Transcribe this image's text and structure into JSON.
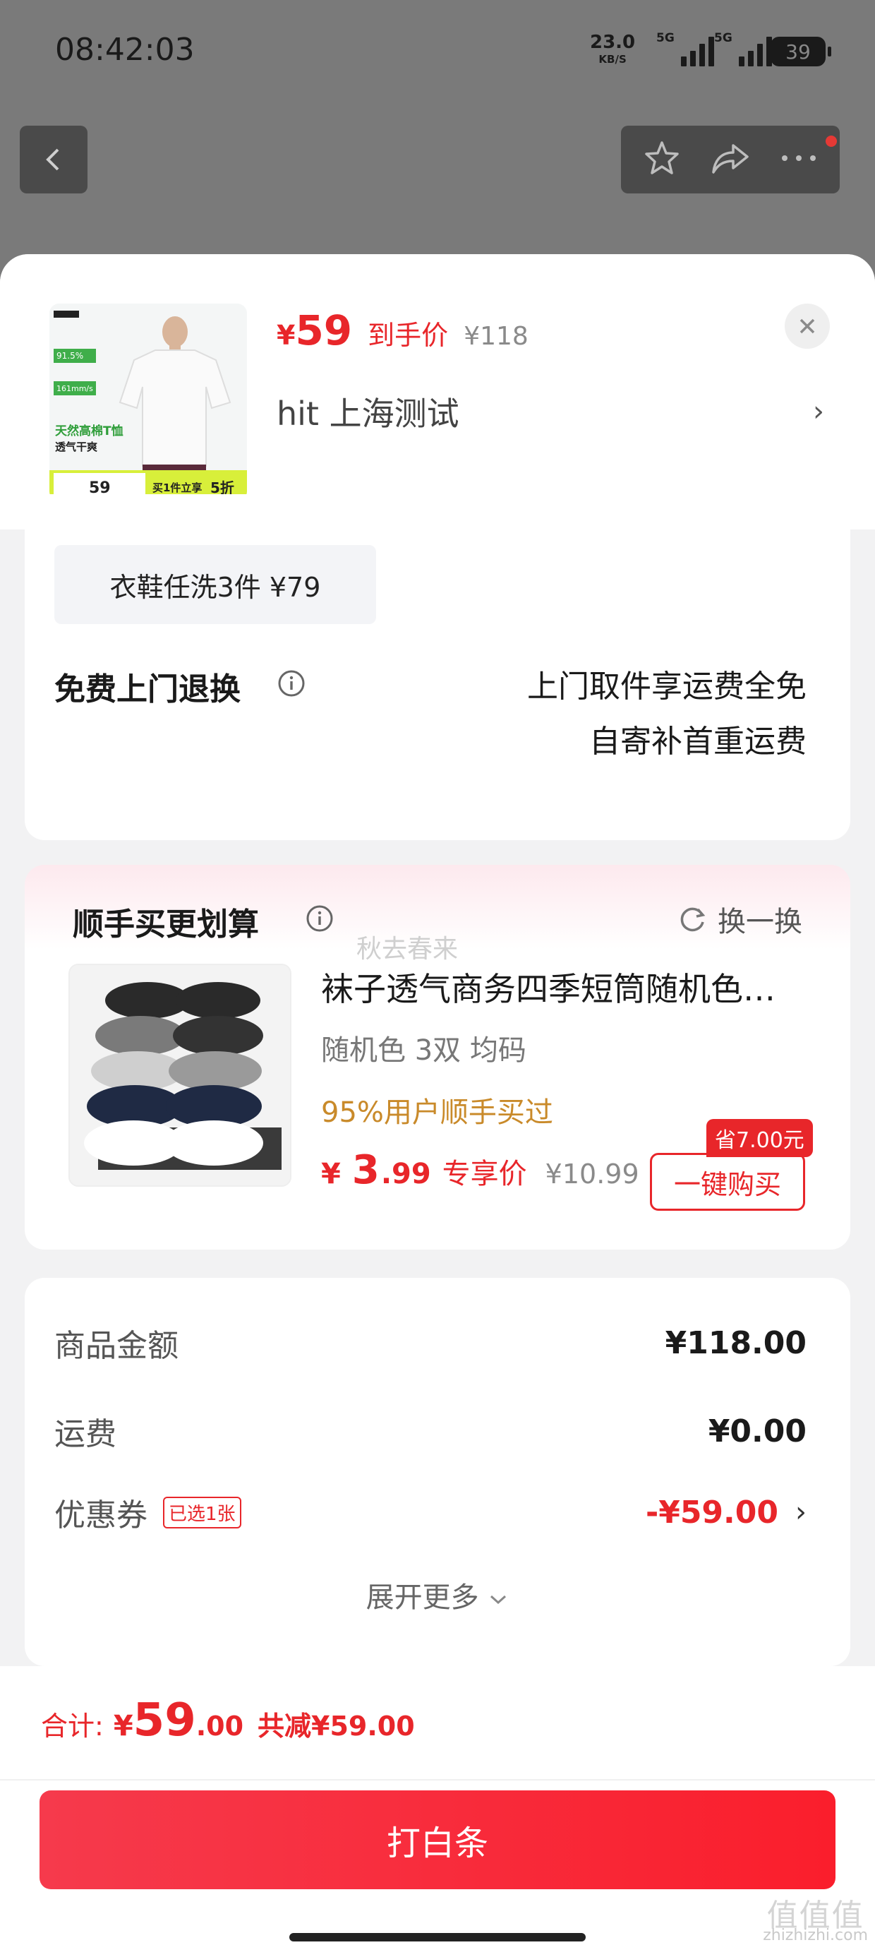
{
  "status_bar": {
    "time": "08:42:03",
    "net_speed": "23.0",
    "net_unit": "KB/S",
    "signal_1": "5G",
    "signal_2": "5G",
    "battery": "39"
  },
  "nav": {
    "icons": [
      "back-icon",
      "star-icon",
      "share-icon",
      "more-icon"
    ]
  },
  "product": {
    "thumb_texts": [
      "91.5%",
      "161mm/s",
      "天然高棉T恤",
      "透气干爽",
      "59",
      "买1件立享",
      "5折"
    ],
    "price_symbol": "¥",
    "price": "59",
    "price_tag": "到手价",
    "original_price": "¥118",
    "spec": "hit  上海测试"
  },
  "promo": {
    "chip": "衣鞋任洗3件  ¥79",
    "return_title": "免费上门退换",
    "return_line1": "上门取件享运费全免",
    "return_line2": "自寄补首重运费"
  },
  "addon": {
    "title": "顺手买更划算",
    "refresh_label": "换一换",
    "watermark": "秋去春来",
    "name": "袜子透气商务四季短筒随机色…",
    "spec": "随机色 3双   均码",
    "social_proof": "95%用户顺手买过",
    "price_symbol": "¥",
    "price_int": "3",
    "price_dec": ".99",
    "price_tag": "专享价",
    "original_price": "¥10.99",
    "save_badge": "省7.00元",
    "buy_label": "一键购买"
  },
  "summary": {
    "goods_label": "商品金额",
    "goods_value": "¥118.00",
    "shipping_label": "运费",
    "shipping_value": "¥0.00",
    "coupon_label": "优惠券",
    "coupon_badge": "已选1张",
    "coupon_value": "-¥59.00",
    "expand_label": "展开更多"
  },
  "footer": {
    "total_label": "合计:",
    "total_symbol": "¥",
    "total_int": "59",
    "total_dec": ".00",
    "total_saved": "共减¥59.00",
    "pay_label": "打白条",
    "site_mark_big": "值值值",
    "site_mark_url": "zhizhizhi.com"
  },
  "colors": {
    "accent": "#e8262a",
    "gold": "#c98a2a",
    "overlay": "#7a7a7a"
  }
}
